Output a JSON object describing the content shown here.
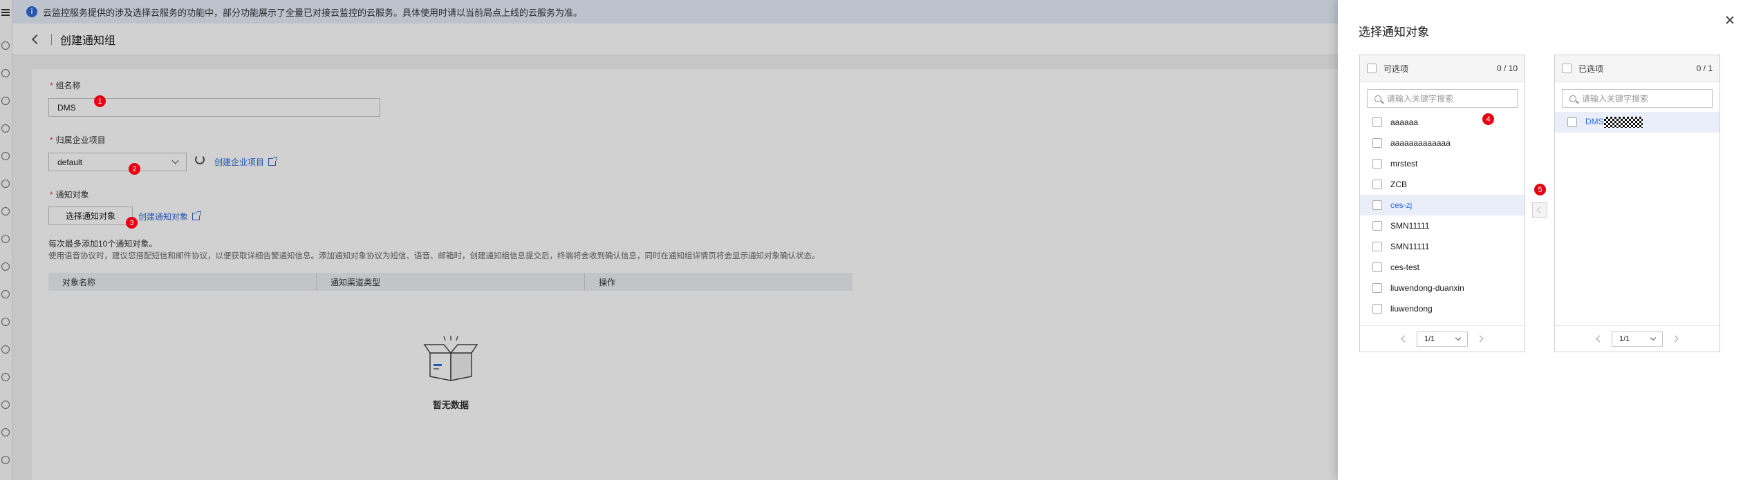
{
  "notice": {
    "text": "云监控服务提供的涉及选择云服务的功能中，部分功能展示了全量已对接云监控的云服务。具体使用时请以当前局点上线的云服务为准。"
  },
  "header": {
    "title": "创建通知组"
  },
  "form": {
    "group_name": {
      "label": "组名称",
      "value": "DMS"
    },
    "enterprise_project": {
      "label": "归属企业项目",
      "value": "default",
      "create_link": "创建企业项目"
    },
    "notify_target": {
      "label": "通知对象",
      "select_button": "选择通知对象",
      "create_link": "创建通知对象"
    },
    "hint_main": "每次最多添加10个通知对象。",
    "hint_sub": "使用语音协议时，建议您搭配短信和邮件协议，以便获取详细告警通知信息。添加通知对象协议为短信、语音、邮箱时，创建通知组信息提交后，终端将会收到确认信息，同时在通知组详情页将会显示通知对象确认状态。"
  },
  "table": {
    "columns": [
      "对象名称",
      "通知渠道类型",
      "操作"
    ],
    "empty_text": "暂无数据"
  },
  "badges": [
    "1",
    "2",
    "3",
    "4",
    "5"
  ],
  "drawer": {
    "title": "选择通知对象",
    "available": {
      "title": "可选项",
      "count": "0 / 10",
      "search_placeholder": "请输入关键字搜索",
      "items": [
        "aaaaaa",
        "aaaaaaaaaaaaa",
        "mrstest",
        "ZCB",
        "ces-zj",
        "SMN11111",
        "SMN11111",
        "ces-test",
        "liuwendong-duanxin",
        "liuwendong"
      ],
      "active_index": 4,
      "page": "1/1"
    },
    "selected": {
      "title": "已选项",
      "count": "0 / 1",
      "search_placeholder": "请输入关键字搜索",
      "items": [
        "DMS"
      ],
      "page": "1/1"
    }
  },
  "colors": {
    "accent": "#2f6bd8",
    "badge": "#e60012",
    "required": "#e63e3e"
  }
}
